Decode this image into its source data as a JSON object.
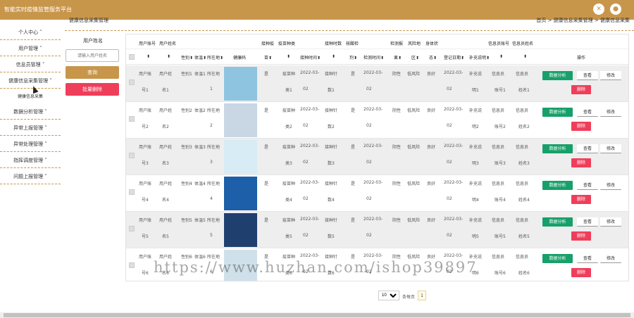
{
  "app_title": "智能实时疫情监管服务平台",
  "breadcrumb_left": "健康信息采集管理",
  "breadcrumb_right": "首页 > 健康信息采集管理 > 健康信息采集",
  "header_icons": [
    "swap-icon",
    "user-icon"
  ],
  "sidebar": {
    "items": [
      {
        "label": "个人中心"
      },
      {
        "label": "用户管理"
      },
      {
        "label": "信息员管理"
      },
      {
        "label": "健康信息采集管理"
      },
      {
        "label": "数据分析管理"
      },
      {
        "label": "异常上报管理"
      },
      {
        "label": "异常处理管理"
      },
      {
        "label": "指挥调度管理"
      },
      {
        "label": "问题上报管理"
      }
    ],
    "subitem": "健康信息采集"
  },
  "search": {
    "label": "用户姓名",
    "placeholder": "请输入用户姓名",
    "search_btn": "查询",
    "batch_delete_btn": "批量删除"
  },
  "table": {
    "header_row1": [
      "用户账号",
      "用户姓名",
      "体温",
      "接种疫",
      "疫苗种类",
      "接种时数",
      "核酸检",
      "检测报",
      "风险地",
      "身体状",
      "信息员账号",
      "信息员姓名"
    ],
    "header_row2": [
      "性别",
      "体温",
      "所在地",
      "健康码",
      "苗",
      "接种时间",
      "剂",
      "检测时间",
      "果",
      "区",
      "态",
      "登记日期",
      "补充说明",
      "操作"
    ],
    "rows": [
      {
        "account": "用户账号1",
        "name": "用户姓名1",
        "gender": "性别1",
        "temp": "体温1",
        "loc": "所在地1",
        "vacc": "是",
        "type": "疫苗种类1",
        "vtime": "2022-03-02",
        "dose": "接种针数1",
        "nucl": "是",
        "ntime": "2022-03-02",
        "result": "阴性",
        "risk": "低风险",
        "body": "良好",
        "reg": "2022-03-02",
        "note": "补充说明1",
        "info_acc": "信息员账号1",
        "info_name": "信息员姓名1",
        "img": "img-medical"
      },
      {
        "account": "用户账号2",
        "name": "用户姓名2",
        "gender": "性别2",
        "temp": "体温2",
        "loc": "所在地2",
        "vacc": "是",
        "type": "疫苗种类2",
        "vtime": "2022-03-02",
        "dose": "接种针数2",
        "nucl": "是",
        "ntime": "2022-03-02",
        "result": "阴性",
        "risk": "低风险",
        "body": "良好",
        "reg": "2022-03-02",
        "note": "补充说明2",
        "info_acc": "信息员账号2",
        "info_name": "信息员姓名2",
        "img": "img-hands"
      },
      {
        "account": "用户账号3",
        "name": "用户姓名3",
        "gender": "性别3",
        "temp": "体温3",
        "loc": "所在地3",
        "vacc": "是",
        "type": "疫苗种类3",
        "vtime": "2022-03-02",
        "dose": "接种针数3",
        "nucl": "是",
        "ntime": "2022-03-02",
        "result": "阴性",
        "risk": "低风险",
        "body": "良好",
        "reg": "2022-03-02",
        "note": "补充说明3",
        "info_acc": "信息员账号3",
        "info_name": "信息员姓名3",
        "img": "img-doctors"
      },
      {
        "account": "用户账号4",
        "name": "用户姓名4",
        "gender": "性别4",
        "temp": "体温4",
        "loc": "所在地4",
        "vacc": "是",
        "type": "疫苗种类4",
        "vtime": "2022-03-02",
        "dose": "接种针数4",
        "nucl": "是",
        "ntime": "2022-03-02",
        "result": "阴性",
        "risk": "低风险",
        "body": "良好",
        "reg": "2022-03-02",
        "note": "补充说明4",
        "info_acc": "信息员账号4",
        "info_name": "信息员姓名4",
        "img": "img-poster"
      },
      {
        "account": "用户账号5",
        "name": "用户姓名5",
        "gender": "性别5",
        "temp": "体温5",
        "loc": "所在地5",
        "vacc": "是",
        "type": "疫苗种类5",
        "vtime": "2022-03-02",
        "dose": "接种针数5",
        "nucl": "是",
        "ntime": "2022-03-02",
        "result": "阴性",
        "risk": "低风险",
        "body": "良好",
        "reg": "2022-03-02",
        "note": "补充说明5",
        "info_acc": "信息员账号5",
        "info_name": "信息员姓名5",
        "img": "img-icon"
      },
      {
        "account": "用户账号6",
        "name": "用户姓名6",
        "gender": "性别6",
        "temp": "体温6",
        "loc": "所在地6",
        "vacc": "是",
        "type": "疫苗种类6",
        "vtime": "2022-03-02",
        "dose": "接种针数6",
        "nucl": "是",
        "ntime": "2022-03-02",
        "result": "阴性",
        "risk": "低风险",
        "body": "良好",
        "reg": "2022-03-02",
        "note": "补充说明6",
        "info_acc": "信息员账号6",
        "info_name": "信息员姓名6",
        "img": "img-mask"
      }
    ],
    "actions": {
      "analyze": "数据分析",
      "view": "查看",
      "edit": "修改",
      "delete": "删除"
    }
  },
  "pagination": {
    "page_size": "10",
    "text": "条每页",
    "current": "1"
  },
  "watermark": "https://www.huzhan.com/ishop39897",
  "colors": {
    "accent": "#c8964b",
    "danger": "#ef3e5a",
    "success": "#17a06a"
  }
}
